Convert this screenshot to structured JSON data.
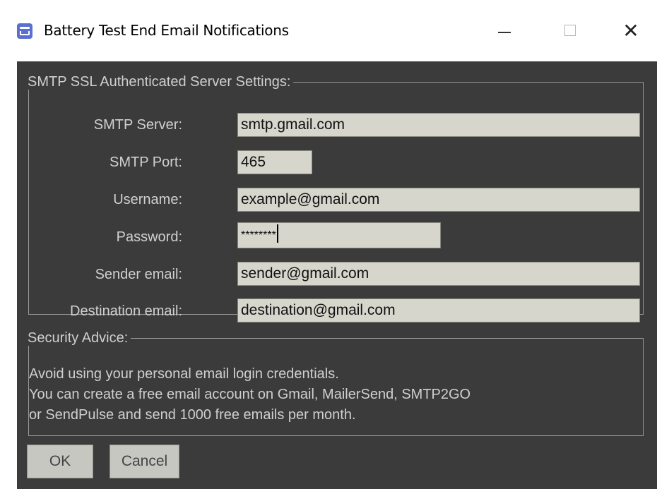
{
  "window": {
    "title": "Battery Test End Email Notifications",
    "controls": {
      "minimize": "—",
      "maximize": "☐",
      "close": "✕"
    }
  },
  "smtp_settings": {
    "legend": "SMTP SSL Authenticated Server Settings:",
    "fields": [
      {
        "label": "SMTP Server:",
        "value": "smtp.gmail.com"
      },
      {
        "label": "SMTP Port:",
        "value": "465"
      },
      {
        "label": "Username:",
        "value": "example@gmail.com"
      },
      {
        "label": "Password:",
        "value": "********"
      },
      {
        "label": "Sender email:",
        "value": "sender@gmail.com"
      },
      {
        "label": "Destination email:",
        "value": "destination@gmail.com"
      }
    ]
  },
  "security_advice": {
    "legend": "Security Advice:",
    "lines": [
      "Avoid using your personal email login credentials.",
      "You can create a free email account on Gmail, MailerSend, SMTP2GO",
      "or SendPulse and send 1000 free emails per month."
    ]
  },
  "buttons": {
    "ok": "OK",
    "cancel": "Cancel"
  },
  "colors": {
    "background": "#3b3b3b",
    "input_bg": "#d6d6cc",
    "text": "#d0d0d0",
    "button_bg": "#c7c7c2"
  }
}
